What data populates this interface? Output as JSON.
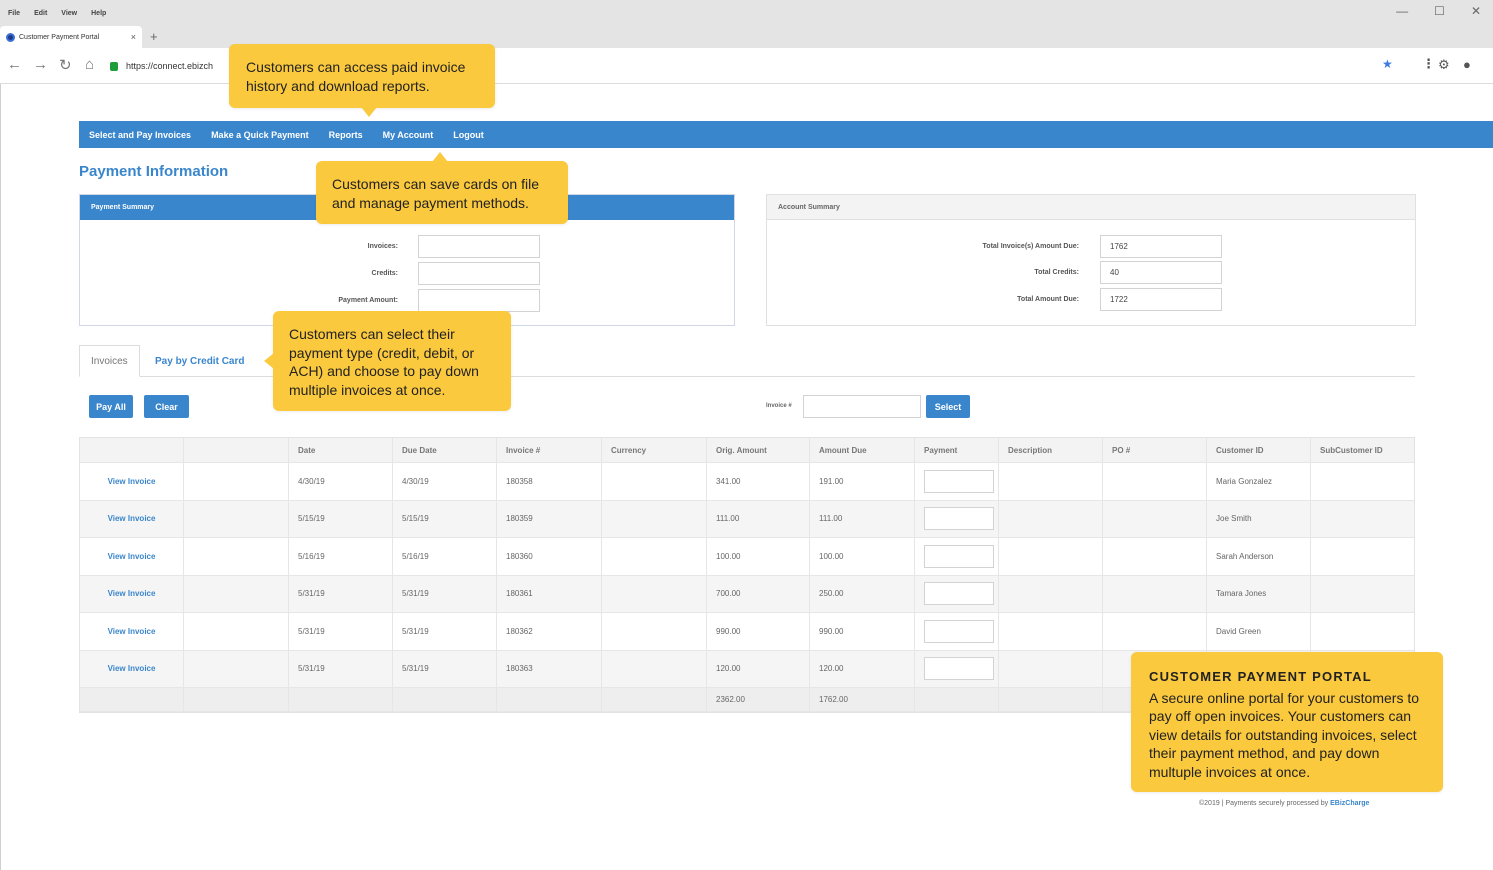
{
  "menu": [
    "File",
    "Edit",
    "View",
    "Help"
  ],
  "window_controls": {
    "minimize": "—",
    "maximize": "☐",
    "close": "✕"
  },
  "tab": {
    "title": "Customer Payment Portal",
    "close": "×",
    "new": "+"
  },
  "address": {
    "url": "https://connect.ebizch"
  },
  "nav": [
    "Select and Pay Invoices",
    "Make a Quick Payment",
    "Reports",
    "My Account",
    "Logout"
  ],
  "page_title": "Payment Information",
  "payment_summary": {
    "title": "Payment Summary",
    "invoices_label": "Invoices:",
    "credits_label": "Credits:",
    "payment_amount_label": "Payment Amount:",
    "invoices_value": "",
    "credits_value": "",
    "payment_amount_value": ""
  },
  "account_summary": {
    "title": "Account Summary",
    "total_due_label": "Total Invoice(s) Amount Due:",
    "total_credits_label": "Total Credits:",
    "total_amount_due_label": "Total Amount Due:",
    "total_due_value": "1762",
    "total_credits_value": "40",
    "total_amount_due_value": "1722"
  },
  "tabs": {
    "invoices": "Invoices",
    "credit_card": "Pay by Credit Card"
  },
  "buttons": {
    "pay_all": "Pay All",
    "clear": "Clear",
    "select": "Select"
  },
  "invoice_search_label": "Invoice #",
  "table": {
    "headers": [
      "",
      "",
      "Date",
      "Due Date",
      "Invoice #",
      "Currency",
      "Orig. Amount",
      "Amount Due",
      "Payment",
      "Description",
      "PO #",
      "Customer ID",
      "SubCustomer ID"
    ],
    "rows": [
      {
        "link": "View Invoice",
        "date": "4/30/19",
        "due": "4/30/19",
        "invoice": "180358",
        "orig": "341.00",
        "amount_due": "191.00",
        "customer": "Maria Gonzalez"
      },
      {
        "link": "View Invoice",
        "date": "5/15/19",
        "due": "5/15/19",
        "invoice": "180359",
        "orig": "111.00",
        "amount_due": "111.00",
        "customer": "Joe Smith"
      },
      {
        "link": "View Invoice",
        "date": "5/16/19",
        "due": "5/16/19",
        "invoice": "180360",
        "orig": "100.00",
        "amount_due": "100.00",
        "customer": "Sarah Anderson"
      },
      {
        "link": "View Invoice",
        "date": "5/31/19",
        "due": "5/31/19",
        "invoice": "180361",
        "orig": "700.00",
        "amount_due": "250.00",
        "customer": "Tamara Jones"
      },
      {
        "link": "View Invoice",
        "date": "5/31/19",
        "due": "5/31/19",
        "invoice": "180362",
        "orig": "990.00",
        "amount_due": "990.00",
        "customer": "David Green"
      },
      {
        "link": "View Invoice",
        "date": "5/31/19",
        "due": "5/31/19",
        "invoice": "180363",
        "orig": "120.00",
        "amount_due": "120.00",
        "customer": ""
      }
    ],
    "totals": {
      "orig": "2362.00",
      "amount_due": "1762.00"
    }
  },
  "callouts": {
    "reports": "Customers can access paid invoice history and download reports.",
    "account": "Customers can save cards on file and manage payment methods.",
    "payment_type": "Customers can select their payment type (credit, debit, or ACH) and choose to pay down multiple invoices at once.",
    "portal_heading": "CUSTOMER PAYMENT PORTAL",
    "portal_body": "A secure online portal for your customers to pay off open invoices. Your customers can view details for outstanding invoices, select their payment method, and pay down multuple invoices at once."
  },
  "footer": {
    "prefix": "©2019 | Payments securely processed by ",
    "brand": "EBizCharge"
  },
  "colors": {
    "primary": "#3a86cc",
    "callout": "#fbc93d"
  }
}
